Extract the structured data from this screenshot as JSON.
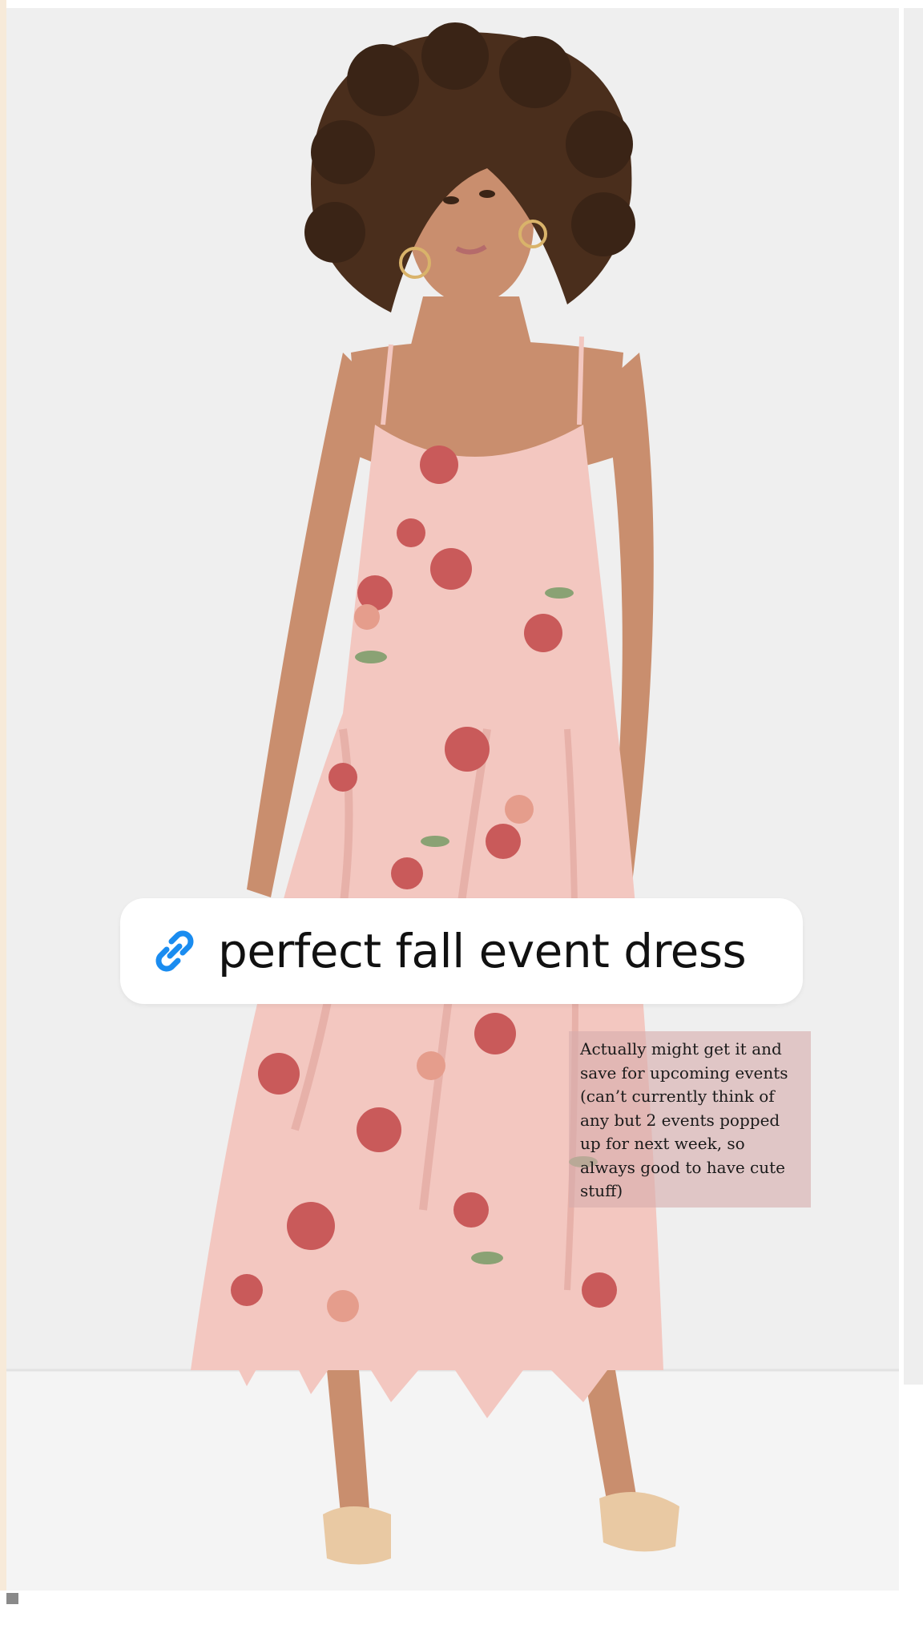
{
  "link_sticker": {
    "icon": "link-icon",
    "icon_color": "#1a8cf0",
    "text": "perfect fall event dress"
  },
  "note": {
    "text": "Actually might get it and save for upcoming events (can’t currently think of any but 2 events popped up for next week, so always good to have cute stuff)",
    "background": "#d6acac"
  },
  "photo": {
    "subject": "model-in-floral-dress",
    "backdrop_color": "#efefef",
    "dress_color": "#f3c7c0",
    "flower_color": "#c95a5a",
    "hair_color": "#4a2e1c",
    "skin_color": "#c98e6e"
  }
}
